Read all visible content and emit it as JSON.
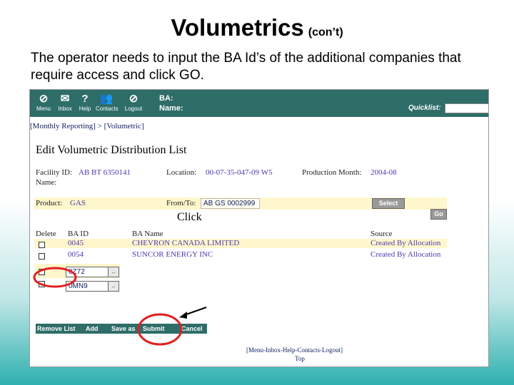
{
  "slide": {
    "title_main": "Volumetrics",
    "title_sub": "(con’t)",
    "body_text": "The operator needs to input the BA Id’s of the additional companies that require access and click GO.",
    "annotation": "Click"
  },
  "app": {
    "nav": [
      {
        "label": "Menu",
        "icon": "compass-icon",
        "glyph": "⊘"
      },
      {
        "label": "Inbox",
        "icon": "mail-icon",
        "glyph": "✉"
      },
      {
        "label": "Help",
        "icon": "help-icon",
        "glyph": "?"
      },
      {
        "label": "Contacts",
        "icon": "contacts-icon",
        "glyph": "👥"
      },
      {
        "label": "Logout",
        "icon": "logout-icon",
        "glyph": "⊘"
      }
    ],
    "ba_label": "BA:",
    "name_label": "Name:",
    "quicklist_label": "Quicklist:",
    "breadcrumb": "[Monthly Reporting] > [Volumetric]",
    "page_title": "Edit Volumetric Distribution List",
    "facility_id_label": "Facility ID:",
    "facility_id": "AB BT 6350141",
    "location_label": "Location:",
    "location": "00-07-35-047-09 W5",
    "production_month_label": "Production Month:",
    "production_month": "2004-08",
    "name_field_label": "Name:",
    "product_label": "Product:",
    "product": "GAS",
    "from_to_label": "From/To:",
    "from_to": "AB GS 0002999",
    "select_button": "Select",
    "go_button": "Go",
    "table": {
      "headers": [
        "Delete",
        "BA ID",
        "BA Name",
        "Source"
      ],
      "rows": [
        {
          "ba_id": "0045",
          "ba_name": "CHEVRON CANADA LIMITED",
          "source": "Created By Allocation"
        },
        {
          "ba_id": "0054",
          "ba_name": "SUNCOR ENERGY INC",
          "source": "Created By Allocation"
        }
      ],
      "new_entries": [
        {
          "value": "0Z72",
          "lookup": ".."
        },
        {
          "value": "0MN9",
          "lookup": ".."
        }
      ]
    },
    "buttons": {
      "remove_list": "Remove List",
      "add": "Add",
      "save_as": "Save as",
      "submit": "Submit",
      "cancel": "Cancel"
    },
    "footer_links": "[Menu-Inbox-Help-Contacts-Logout]",
    "top_link": "Top"
  },
  "colors": {
    "header_bar": "#2e6d68",
    "highlight_row": "#fff7cc",
    "annotation_circle": "#e02020"
  }
}
